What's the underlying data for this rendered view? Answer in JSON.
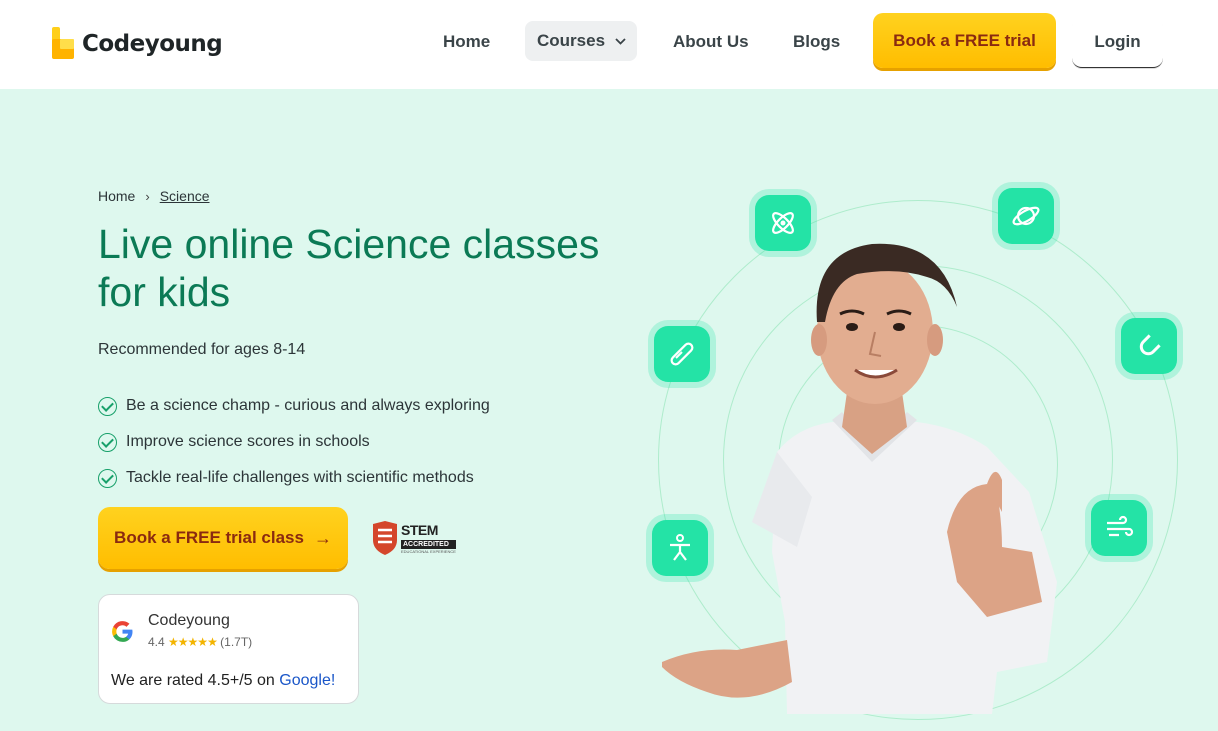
{
  "header": {
    "logo_text": "Codeyoung",
    "nav": {
      "home": "Home",
      "courses": "Courses",
      "about": "About Us",
      "blogs": "Blogs"
    },
    "cta_label": "Book a FREE trial",
    "login_label": "Login"
  },
  "breadcrumb": {
    "home": "Home",
    "current": "Science"
  },
  "hero": {
    "title": "Live online Science classes for kids",
    "subtitle": "Recommended for ages 8-14",
    "bullets": [
      "Be a science champ - curious and always exploring",
      "Improve science scores in schools",
      "Tackle real-life challenges with scientific methods"
    ],
    "cta_label": "Book a FREE trial class",
    "cta_arrow": "→",
    "badge": {
      "word": "STEM",
      "accredited": "ACCREDITED",
      "small": "EDUCATIONAL EXPERIENCE"
    },
    "icons": [
      "atom-icon",
      "planet-icon",
      "test-tube-icon",
      "magnet-icon",
      "person-icon",
      "wind-icon"
    ]
  },
  "review": {
    "brand": "Codeyoung",
    "score": "4.4",
    "stars": "★★★★★",
    "count": "(1.7T)",
    "rated_prefix": "We are rated 4.5+/5 on",
    "rated_link": "Google!"
  },
  "colors": {
    "background": "#def8ee",
    "title": "#0b7a55",
    "cta": "#ffc107",
    "cta_text": "#8a2a10",
    "icon_badge": "#24e3a6",
    "check": "#18a06a"
  }
}
